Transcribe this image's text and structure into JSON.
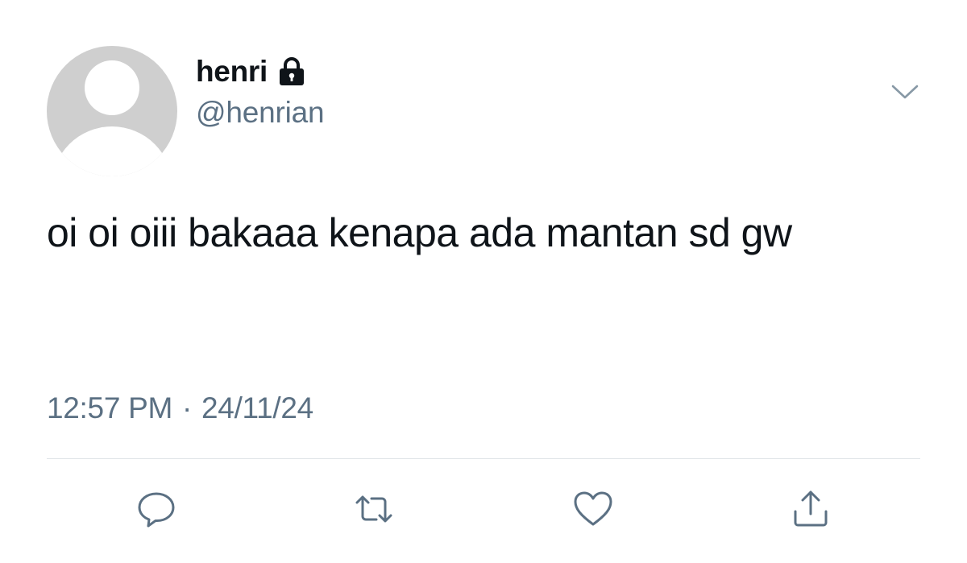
{
  "user": {
    "display_name": "henri",
    "handle": "@henrian",
    "protected_icon": "lock-icon",
    "avatar_icon": "default-avatar-icon"
  },
  "tweet": {
    "text": "oi oi oiii bakaaa kenapa ada mantan sd gw",
    "time": "12:57 PM",
    "separator": "·",
    "date": "24/11/24"
  },
  "actions": {
    "reply_icon": "reply-icon",
    "retweet_icon": "retweet-icon",
    "like_icon": "heart-icon",
    "share_icon": "share-icon",
    "menu_icon": "chevron-down-icon"
  },
  "colors": {
    "text_primary": "#0f1419",
    "text_secondary": "#5b7083",
    "icon": "#5b7083",
    "avatar_bg": "#cfcfcf",
    "divider": "#dfe3e7"
  }
}
